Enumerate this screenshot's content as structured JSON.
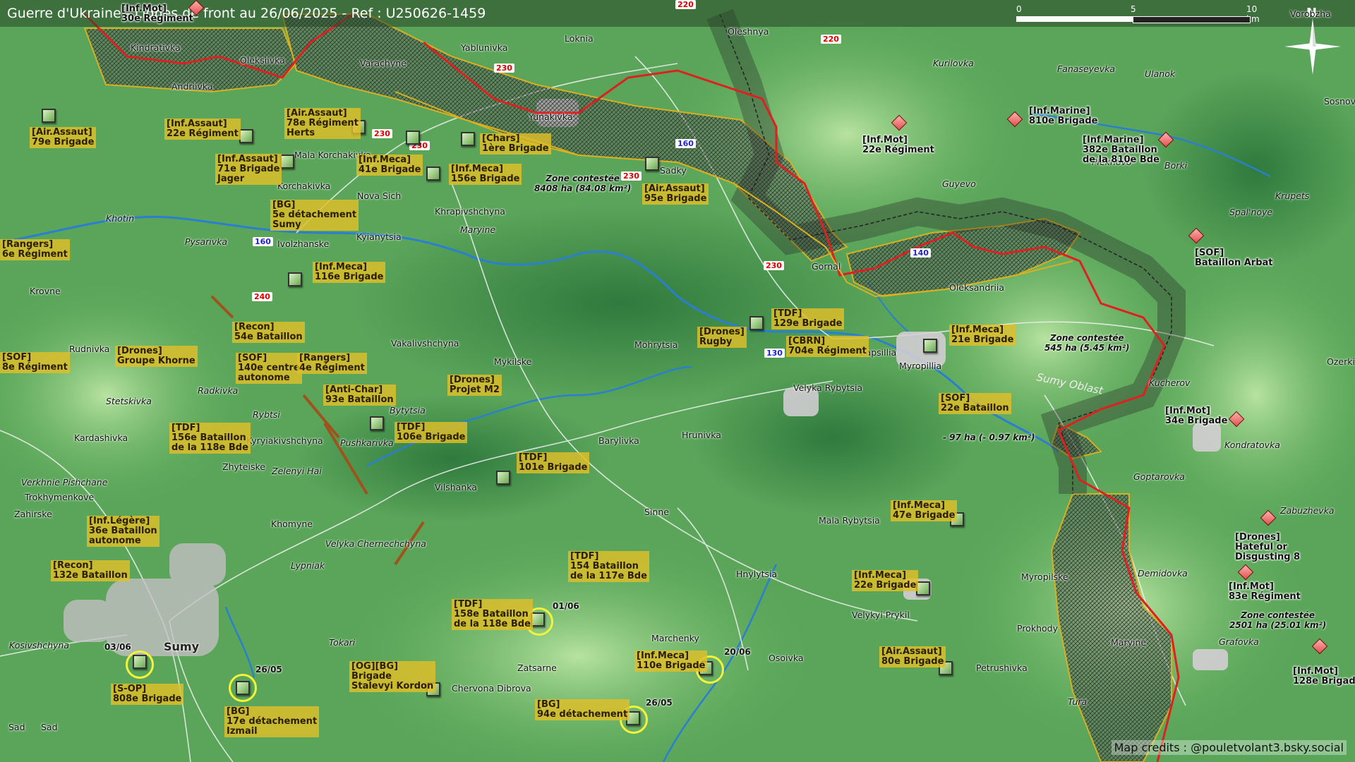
{
  "header": {
    "title": "Guerre d'Ukraine - Lignes de front au 26/06/2025 - Ref : U250626-1459"
  },
  "scale_bar": {
    "labels": [
      "0",
      "5",
      "10 km"
    ]
  },
  "compass": {
    "label": "N"
  },
  "credits": "Map credits : @pouletvolant3.bsky.social",
  "colors": {
    "front_line": "#e02020",
    "contested_border": "#d8b020",
    "unit_label": "#e1be28",
    "river": "#2a7fd0"
  },
  "places": [
    {
      "name": "Kindrativka"
    },
    {
      "name": "Oleksiivka"
    },
    {
      "name": "Andriivka"
    },
    {
      "name": "Yablunivka"
    },
    {
      "name": "Loknia"
    },
    {
      "name": "Varachyne"
    },
    {
      "name": "Yunakivka"
    },
    {
      "name": "Sadky"
    },
    {
      "name": "Oleshnya"
    },
    {
      "name": "Kurilovka"
    },
    {
      "name": "Fanaseyevka"
    },
    {
      "name": "Ulanok"
    },
    {
      "name": "Mala Korchakivka"
    },
    {
      "name": "Korchakivka"
    },
    {
      "name": "Nova Sich"
    },
    {
      "name": "Khrapivshchyna"
    },
    {
      "name": "Khotin"
    },
    {
      "name": "Pysarivka"
    },
    {
      "name": "Ivolzhanske"
    },
    {
      "name": "Kyianytsia"
    },
    {
      "name": "Maryine"
    },
    {
      "name": "Guyevo"
    },
    {
      "name": "Plekhovo"
    },
    {
      "name": "Borki"
    },
    {
      "name": "Krupets"
    },
    {
      "name": "Spal'noye"
    },
    {
      "name": "Gornal"
    },
    {
      "name": "Oleksandriia"
    },
    {
      "name": "Krovne"
    },
    {
      "name": "Rudnivka"
    },
    {
      "name": "Vakalivshchyna"
    },
    {
      "name": "Mykilske"
    },
    {
      "name": "Mohrytsia"
    },
    {
      "name": "Zapsillia"
    },
    {
      "name": "Myropillia"
    },
    {
      "name": "Velyka Rybytsia"
    },
    {
      "name": "Kucherov"
    },
    {
      "name": "Radkivka"
    },
    {
      "name": "Stetskivka"
    },
    {
      "name": "Bytytsia"
    },
    {
      "name": "Rybtsi"
    },
    {
      "name": "Kyryiakivshchyna"
    },
    {
      "name": "Kardashivka"
    },
    {
      "name": "Pushkarivka"
    },
    {
      "name": "Zhyteiske"
    },
    {
      "name": "Zelenyi Hai"
    },
    {
      "name": "Barylivka"
    },
    {
      "name": "Hrunivka"
    },
    {
      "name": "Vilshanka"
    },
    {
      "name": "Verkhnie Pishchane"
    },
    {
      "name": "Trokhymenkove"
    },
    {
      "name": "Zahirske"
    },
    {
      "name": "Sinne"
    },
    {
      "name": "Mala Rybytsia"
    },
    {
      "name": "Goptarovka"
    },
    {
      "name": "Zabuzhevka"
    },
    {
      "name": "Kondratovka"
    },
    {
      "name": "Khomyne"
    },
    {
      "name": "Velyka Chernechchyna"
    },
    {
      "name": "Lypniak"
    },
    {
      "name": "Hnylytsia"
    },
    {
      "name": "Myropilske"
    },
    {
      "name": "Demidovka"
    },
    {
      "name": "Velykyi Prykil"
    },
    {
      "name": "Prokhody"
    },
    {
      "name": "Maryine"
    },
    {
      "name": "Grafovka"
    },
    {
      "name": "Marchenky"
    },
    {
      "name": "Osoivka"
    },
    {
      "name": "Petrushivka"
    },
    {
      "name": "Zatsarne"
    },
    {
      "name": "Tokari"
    },
    {
      "name": "Chervona Dibrova"
    },
    {
      "name": "Kosivshchyna"
    },
    {
      "name": "Sad"
    },
    {
      "name": "Sumy"
    },
    {
      "name": "Tura"
    },
    {
      "name": "Sumy Oblast"
    },
    {
      "name": "Vorobzha"
    },
    {
      "name": "Sosnovo Bor"
    },
    {
      "name": "Ozerki"
    },
    {
      "name": "Sad"
    }
  ],
  "roads": [
    "220",
    "220",
    "230",
    "230",
    "160",
    "230",
    "230",
    "230",
    "140",
    "160",
    "240",
    "130"
  ],
  "units": [
    {
      "label": "[Inf.Mot]\n30e Régiment",
      "side": "ru"
    },
    {
      "label": "[Air.Assaut]\n79e Brigade",
      "side": "ua"
    },
    {
      "label": "[Inf.Assaut]\n22e Régiment",
      "side": "ua"
    },
    {
      "label": "[Air.Assaut]\n78e Régiment\nHerts",
      "side": "ua"
    },
    {
      "label": "[Chars]\n1ère Brigade",
      "side": "ua"
    },
    {
      "label": "[Inf.Assaut]\n71e Brigade\nJager",
      "side": "ua"
    },
    {
      "label": "[Inf.Meca]\n41e Brigade",
      "side": "ua"
    },
    {
      "label": "[Inf.Meca]\n156e Brigade",
      "side": "ua"
    },
    {
      "label": "[Air.Assaut]\n95e Brigade",
      "side": "ua"
    },
    {
      "label": "[BG]\n5e détachement\nSumy",
      "side": "ua"
    },
    {
      "label": "[Rangers]\n6e Régiment",
      "side": "ua"
    },
    {
      "label": "[Inf.Meca]\n116e Brigade",
      "side": "ua"
    },
    {
      "label": "[Recon]\n54e Bataillon",
      "side": "ua"
    },
    {
      "label": "[Drones]\nGroupe Khorne",
      "side": "ua"
    },
    {
      "label": "[SOF]\n140e centre\nautonome",
      "side": "ua"
    },
    {
      "label": "[Rangers]\n4e Régiment",
      "side": "ua"
    },
    {
      "label": "[SOF]\n8e Régiment",
      "side": "ua"
    },
    {
      "label": "[Drones]\nProjet M2",
      "side": "ua"
    },
    {
      "label": "[Anti-Char]\n93e Bataillon",
      "side": "ua"
    },
    {
      "label": "[TDF]\n156e Bataillon\nde la 118e Bde",
      "side": "ua"
    },
    {
      "label": "[TDF]\n106e Brigade",
      "side": "ua"
    },
    {
      "label": "[TDF]\n101e Brigade",
      "side": "ua"
    },
    {
      "label": "[Drones]\nRugby",
      "side": "ua"
    },
    {
      "label": "[TDF]\n129e Brigade",
      "side": "ua"
    },
    {
      "label": "[CBRN]\n704e Régiment",
      "side": "ua"
    },
    {
      "label": "[Inf.Meca]\n21e Brigade",
      "side": "ua"
    },
    {
      "label": "[SOF]\n22e Bataillon",
      "side": "ua"
    },
    {
      "label": "[Inf.Légère]\n36e Bataillon\nautonome",
      "side": "ua"
    },
    {
      "label": "[Recon]\n132e Bataillon",
      "side": "ua"
    },
    {
      "label": "[Inf.Meca]\n47e Brigade",
      "side": "ua"
    },
    {
      "label": "[TDF]\n154 Bataillon\nde la 117e Bde",
      "side": "ua"
    },
    {
      "label": "[Inf.Meca]\n22e Brigade",
      "side": "ua"
    },
    {
      "label": "[TDF]\n158e Bataillon\nde la 118e Bde",
      "side": "ua"
    },
    {
      "label": "[Air.Assaut]\n80e Brigade",
      "side": "ua"
    },
    {
      "label": "[Inf.Meca]\n110e Brigade",
      "side": "ua"
    },
    {
      "label": "[OG][BG]\nBrigade\nStalevyi Kordon",
      "side": "ua"
    },
    {
      "label": "[S-OP]\n808e Brigade",
      "side": "ua"
    },
    {
      "label": "[BG]\n17e détachement\nIzmail",
      "side": "ua"
    },
    {
      "label": "[BG]\n94e détachement",
      "side": "ua"
    },
    {
      "label": "[Inf.Marine]\n810e Brigade",
      "side": "ru"
    },
    {
      "label": "[Inf.Mot]\n22e Régiment",
      "side": "ru"
    },
    {
      "label": "[Inf.Marine]\n382e Bataillon\nde la 810e Bde",
      "side": "ru"
    },
    {
      "label": "[SOF]\nBataillon Arbat",
      "side": "ru"
    },
    {
      "label": "[Inf.Mot]\n34e Brigade",
      "side": "ru"
    },
    {
      "label": "[Drones]\nHateful or\nDisgusting 8",
      "side": "ru"
    },
    {
      "label": "[Inf.Mot]\n83e Régiment",
      "side": "ru"
    },
    {
      "label": "[Inf.Mot]\n128e Brigade",
      "side": "ru"
    }
  ],
  "zones": [
    {
      "label": "Zone contestée\n8408 ha (84.08 km²)"
    },
    {
      "label": "Zone contestée\n545 ha (5.45 km²)"
    },
    {
      "label": "- 97 ha (- 0.97 km²)"
    },
    {
      "label": "Zone contestée\n2501 ha (25.01 km²)"
    }
  ],
  "dates": [
    "01/06",
    "03/06",
    "26/05",
    "20/06",
    "26/05"
  ]
}
